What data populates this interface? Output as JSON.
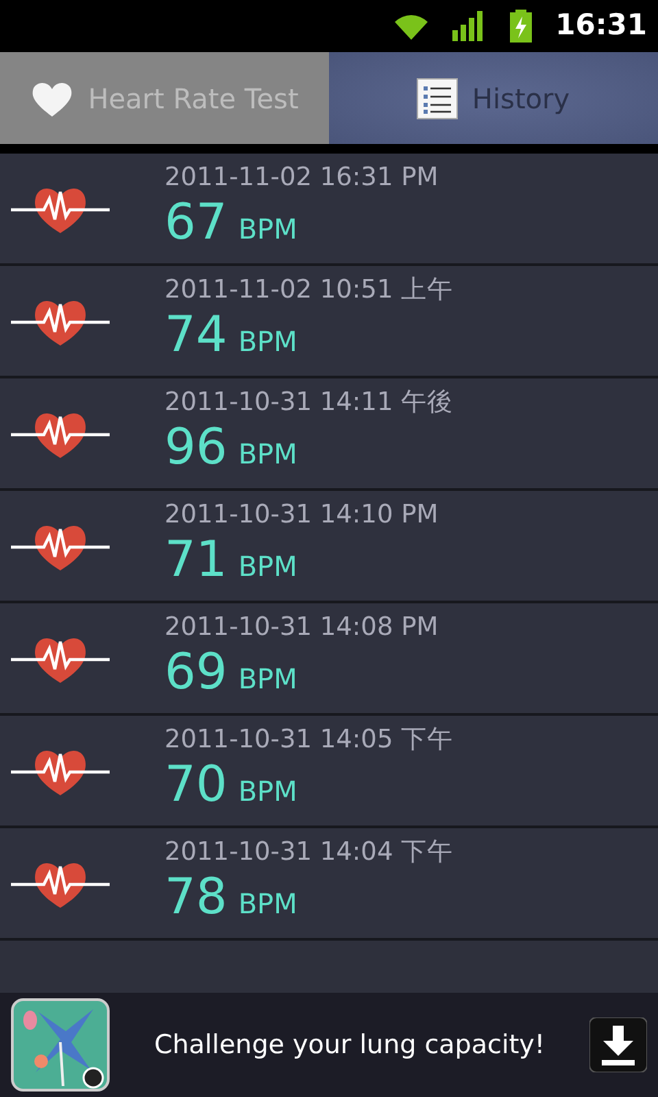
{
  "status_bar": {
    "time": "16:31"
  },
  "tabs": [
    {
      "label": "Heart Rate Test",
      "selected": false
    },
    {
      "label": "History",
      "selected": true
    }
  ],
  "history": [
    {
      "datetime": "2011-11-02 16:31 PM",
      "value": "67",
      "unit": "BPM"
    },
    {
      "datetime": "2011-11-02 10:51 上午",
      "value": "74",
      "unit": "BPM"
    },
    {
      "datetime": "2011-10-31 14:11 午後",
      "value": "96",
      "unit": "BPM"
    },
    {
      "datetime": "2011-10-31 14:10 PM",
      "value": "71",
      "unit": "BPM"
    },
    {
      "datetime": "2011-10-31 14:08 PM",
      "value": "69",
      "unit": "BPM"
    },
    {
      "datetime": "2011-10-31 14:05 下午",
      "value": "70",
      "unit": "BPM"
    },
    {
      "datetime": "2011-10-31 14:04 下午",
      "value": "78",
      "unit": "BPM"
    }
  ],
  "ad": {
    "text": "Challenge your lung capacity!"
  }
}
